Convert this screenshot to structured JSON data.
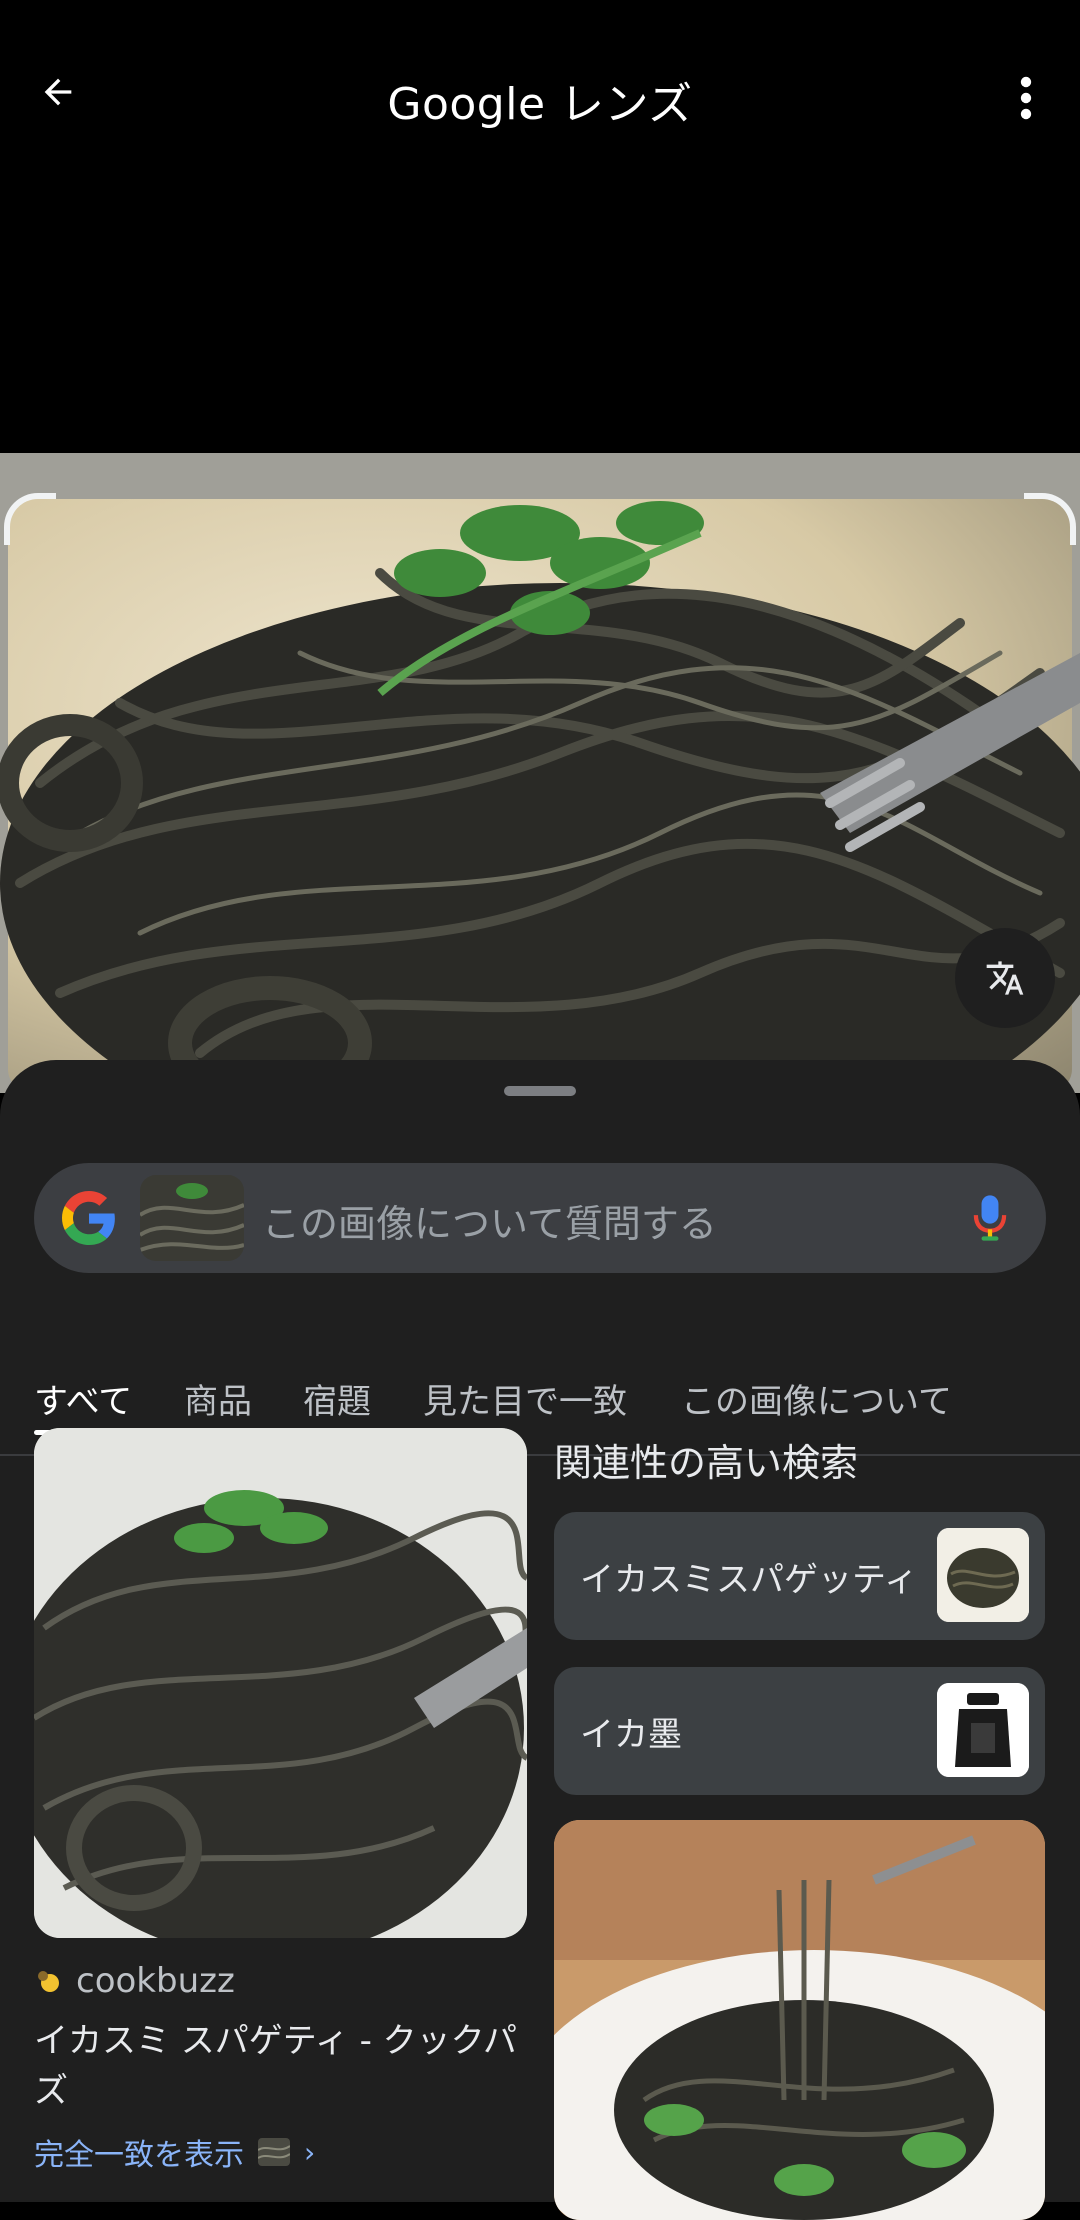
{
  "app": {
    "title": "Google レンズ"
  },
  "search": {
    "placeholder": "この画像について質問する"
  },
  "tabs": [
    {
      "label": "すべて",
      "active": true
    },
    {
      "label": "商品",
      "active": false
    },
    {
      "label": "宿題",
      "active": false
    },
    {
      "label": "見た目で一致",
      "active": false
    },
    {
      "label": "この画像について",
      "active": false
    }
  ],
  "result": {
    "source": "cookbuzz",
    "title": "イカスミ スパゲティ - クックパズ",
    "exact_match_label": "完全一致を表示"
  },
  "related": {
    "heading": "関連性の高い検索",
    "items": [
      {
        "label": "イカスミスパゲッティ"
      },
      {
        "label": "イカ墨"
      }
    ]
  },
  "icons": {
    "back": "arrow-left-icon",
    "menu": "more-vert-icon",
    "translate": "translate-icon",
    "google": "google-g-icon",
    "mic": "mic-icon",
    "chevron": "chevron-right-icon"
  },
  "colors": {
    "sheet_bg": "#1f1f1f",
    "chip_bg": "#3c4043",
    "link": "#8ab4f8",
    "search_bg": "#3c3e42"
  }
}
